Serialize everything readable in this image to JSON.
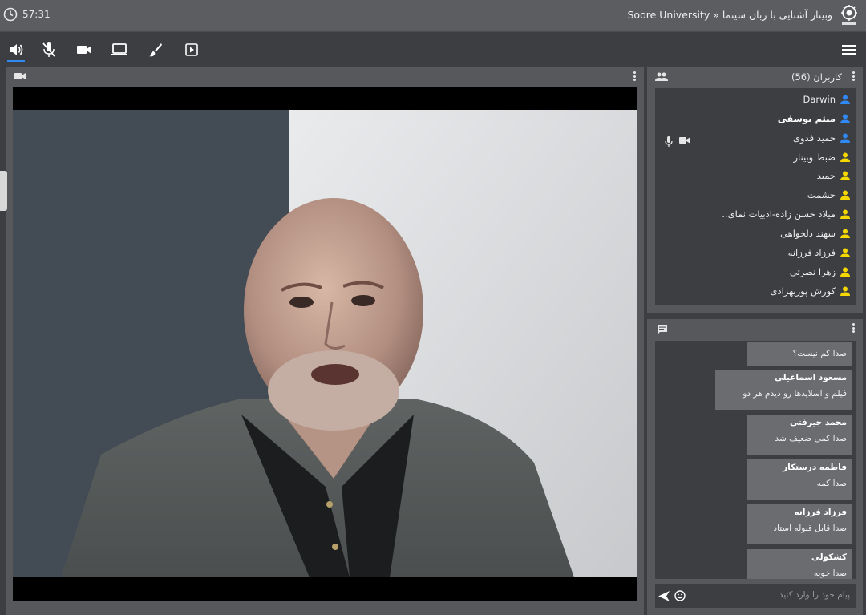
{
  "header": {
    "timer": "57:31",
    "title": "Soore University » وبینار آشنایی با زبان سینما"
  },
  "toolbar": {
    "items": [
      "speaker-icon",
      "mic-off-icon",
      "camera-icon",
      "screen-share-icon",
      "brush-icon",
      "presentation-icon",
      "menu-icon"
    ],
    "active": "speaker-icon"
  },
  "users": {
    "title": "کاربران (56)",
    "list": [
      {
        "name": "Darwin",
        "role": "presenter",
        "bold": false
      },
      {
        "name": "میثم یوسفی",
        "role": "presenter",
        "bold": true
      },
      {
        "name": "حمید فدوی",
        "role": "presenter",
        "bold": false
      },
      {
        "name": "ضبط وبینار",
        "role": "viewer",
        "bold": false
      },
      {
        "name": "حمید",
        "role": "viewer",
        "bold": false
      },
      {
        "name": "حشمت",
        "role": "viewer",
        "bold": false
      },
      {
        "name": "میلاد حسن زاده-ادبیات نمای..",
        "role": "viewer",
        "bold": false
      },
      {
        "name": "سهند دلخواهی",
        "role": "viewer",
        "bold": false
      },
      {
        "name": "فرزاد فرزانه",
        "role": "viewer",
        "bold": false
      },
      {
        "name": "زهرا نصرتی",
        "role": "viewer",
        "bold": false
      },
      {
        "name": "کورش پوربهزادی",
        "role": "viewer",
        "bold": false
      }
    ],
    "colors": {
      "presenter": "#2f8af5",
      "viewer": "#f5d800"
    }
  },
  "chat": {
    "messages": [
      {
        "sender": "",
        "text": "صدا کم نیست؟"
      },
      {
        "sender": "مسعود اسماعیلی",
        "text": "فیلم و اسلایدها رو دیدم هر دو"
      },
      {
        "sender": "محمد جیرفتی",
        "text": "صدا کمی ضعیف شد"
      },
      {
        "sender": "فاطمه درستکار",
        "text": "صدا کمه"
      },
      {
        "sender": "فرزاد فرزانه",
        "text": "صدا قابل قبوله استاد"
      },
      {
        "sender": "کشکولی",
        "text": "صدا خوبه"
      }
    ],
    "placeholder": "پیام خود را وارد کنید"
  }
}
